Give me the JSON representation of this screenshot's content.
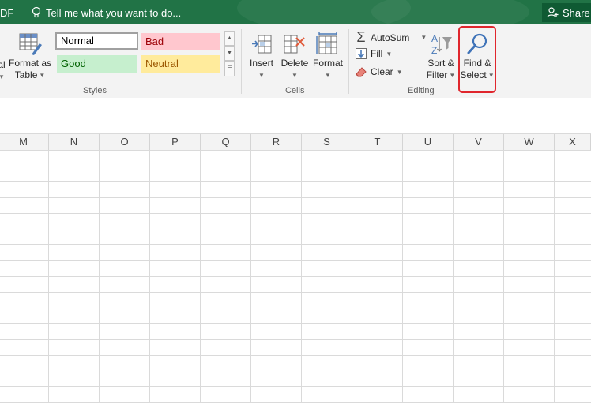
{
  "titlebar": {
    "pdf_tab": "DF",
    "tell_me": "Tell me what you want to do...",
    "share": "Share"
  },
  "ribbon": {
    "styles": {
      "partial_button": "al",
      "format_as_table": [
        "Format as",
        "Table"
      ],
      "gallery": {
        "normal": "Normal",
        "bad": "Bad",
        "good": "Good",
        "neutral": "Neutral"
      },
      "group_label": "Styles"
    },
    "cells": {
      "insert": "Insert",
      "delete": "Delete",
      "format": "Format",
      "group_label": "Cells"
    },
    "editing": {
      "autosum": "AutoSum",
      "fill": "Fill",
      "clear": "Clear",
      "sort_filter": [
        "Sort &",
        "Filter"
      ],
      "find_select": [
        "Find &",
        "Select"
      ],
      "group_label": "Editing"
    }
  },
  "colors": {
    "title_green": "#217346",
    "highlight_red": "#e0262d",
    "bad_fill": "#ffc7ce",
    "bad_text": "#9c0006",
    "good_fill": "#c6efce",
    "good_text": "#006100",
    "neutral_fill": "#ffeb9c",
    "neutral_text": "#9c5700"
  },
  "grid": {
    "columns": [
      "M",
      "N",
      "O",
      "P",
      "Q",
      "R",
      "S",
      "T",
      "U",
      "V",
      "W",
      "X"
    ]
  }
}
